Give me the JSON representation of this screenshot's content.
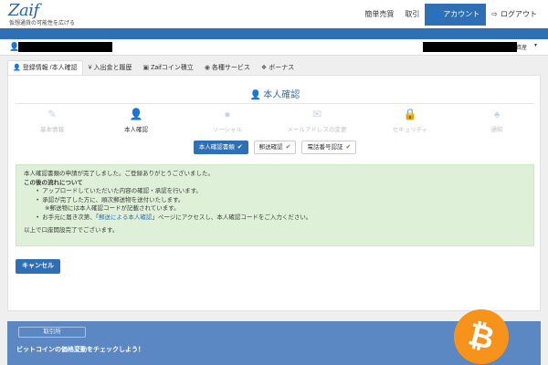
{
  "app": {
    "logo": "Zaif",
    "tagline": "仮想通貨の可能性を広げる"
  },
  "topnav": {
    "items": [
      "簡単売買",
      "取引"
    ],
    "account_label": "アカウント",
    "logout_label": "ログアウト"
  },
  "userbar": {
    "asset_label": "資産"
  },
  "tabs": [
    {
      "label": "登録情報 /本人確認",
      "icon": "user-icon"
    },
    {
      "label": "入出金と履歴",
      "icon": "yen-icon"
    },
    {
      "label": "Zaifコイン積立",
      "icon": "box-icon"
    },
    {
      "label": "各種サービス",
      "icon": "tag-icon"
    },
    {
      "label": "ボーナス",
      "icon": "gift-icon"
    }
  ],
  "page": {
    "title": "本人確認"
  },
  "steps": [
    {
      "label": "基本情報",
      "icon": "pencil-icon"
    },
    {
      "label": "本人確認",
      "icon": "user-icon"
    },
    {
      "label": "ソーシャル",
      "icon": "globe-icon"
    },
    {
      "label": "メールアドレスの変更",
      "icon": "envelope-icon"
    },
    {
      "label": "セキュリティ",
      "icon": "lock-icon"
    },
    {
      "label": "通知",
      "icon": "bell-icon"
    }
  ],
  "substeps": [
    {
      "label": "本人確認書類"
    },
    {
      "label": "郵送確認"
    },
    {
      "label": "電話番号認証"
    }
  ],
  "notice": {
    "line1": "本人確認書類の申請が完了しました。ご登録ありがとうございました。",
    "flow_title": "この後の流れについて",
    "bullet1": "アップロードしていただいた内容の確認・承認を行います。",
    "bullet2": "承認が完了した方に、順次郵送物を送付いたします。",
    "bullet2_note": "※郵送物には本人確認コードが記載されています。",
    "bullet3_pre": "お手元に届き次第、「",
    "bullet3_link": "郵送による本人確認",
    "bullet3_post": "」ページにアクセスし、本人確認コードをご入力ください。",
    "footer": "以上で口座開設完了でございます。"
  },
  "actions": {
    "cancel_label": "キャンセル"
  },
  "banner": {
    "button_label": "取引所",
    "text": "ビットコインの価格変動をチェックしよう！",
    "coin_symbol": "₿"
  },
  "colors": {
    "brand_blue": "#2f6fb5",
    "success_bg": "#dff0d8",
    "bitcoin_orange": "#f7931a"
  }
}
